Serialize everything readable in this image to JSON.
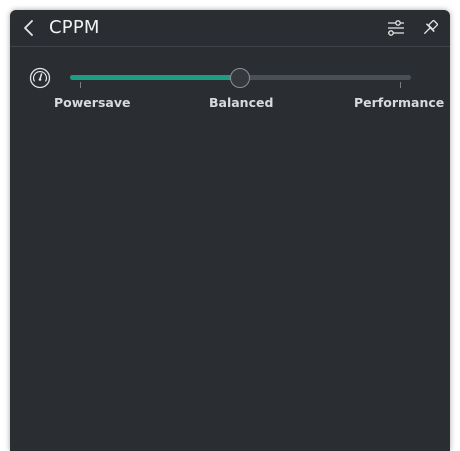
{
  "header": {
    "title": "CPPM",
    "back_icon": "chevron-left-icon",
    "settings_icon": "sliders-icon",
    "pin_icon": "pin-icon"
  },
  "profile_slider": {
    "icon": "gauge-icon",
    "options": [
      "Powersave",
      "Balanced",
      "Performance"
    ],
    "selected": "Balanced",
    "value_fraction": 0.5
  },
  "colors": {
    "panel_background": "#2a2e32",
    "accent": "#1d9e84",
    "track": "#4a4f55",
    "text": "#f2f2f2"
  }
}
